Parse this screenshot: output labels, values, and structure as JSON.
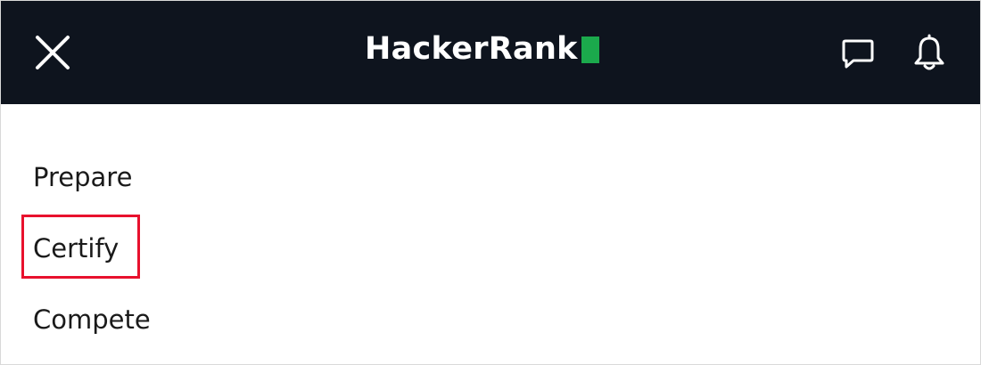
{
  "header": {
    "logo_text": "HackerRank",
    "logo_accent_color": "#1ba94c",
    "background_color": "#0e141e",
    "close_icon": "close-icon",
    "messages_icon": "chat-bubble-icon",
    "notifications_icon": "bell-icon"
  },
  "menu": {
    "items": [
      {
        "label": "Prepare"
      },
      {
        "label": "Certify"
      },
      {
        "label": "Compete"
      }
    ]
  },
  "annotation": {
    "highlight_color": "#e8112d"
  }
}
